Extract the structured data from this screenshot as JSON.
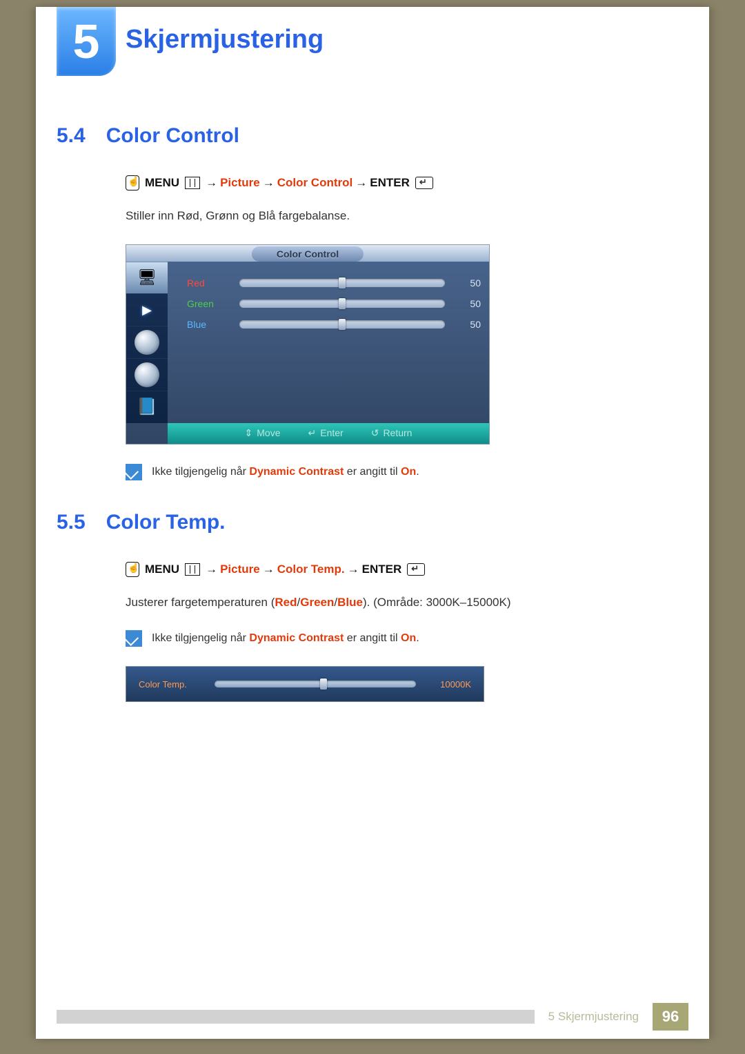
{
  "chapter": {
    "number": "5",
    "title": "Skjermjustering"
  },
  "sections": {
    "s54": {
      "num": "5.4",
      "title": "Color Control",
      "path": {
        "menu": "MENU",
        "p1": "Picture",
        "p2": "Color Control",
        "enter": "ENTER"
      },
      "desc": "Stiller inn Rød, Grønn og Blå fargebalanse.",
      "osd": {
        "title": "Color Control",
        "rows": [
          {
            "label": "Red",
            "cls": "p-red",
            "value": "50"
          },
          {
            "label": "Green",
            "cls": "p-green",
            "value": "50"
          },
          {
            "label": "Blue",
            "cls": "p-blue",
            "value": "50"
          }
        ],
        "footer": {
          "move": "Move",
          "enter": "Enter",
          "ret": "Return"
        }
      },
      "note": {
        "pre": "Ikke tilgjengelig når ",
        "red1": "Dynamic Contrast",
        "mid": " er angitt til ",
        "red2": "On",
        "post": "."
      }
    },
    "s55": {
      "num": "5.5",
      "title": "Color Temp.",
      "path": {
        "menu": "MENU",
        "p1": "Picture",
        "p2": "Color Temp.",
        "enter": "ENTER"
      },
      "desc": {
        "pre": "Justerer fargetemperaturen (",
        "r": "Red",
        "sep1": "/",
        "g": "Green",
        "sep2": "/",
        "b": "Blue",
        "post": "). (Område: 3000K–15000K)"
      },
      "note": {
        "pre": "Ikke tilgjengelig når ",
        "red1": "Dynamic Contrast",
        "mid": " er angitt til ",
        "red2": "On",
        "post": "."
      },
      "osd": {
        "label": "Color Temp.",
        "value": "10000K"
      }
    }
  },
  "footer": {
    "label": "5 Skjermjustering",
    "page": "96"
  }
}
